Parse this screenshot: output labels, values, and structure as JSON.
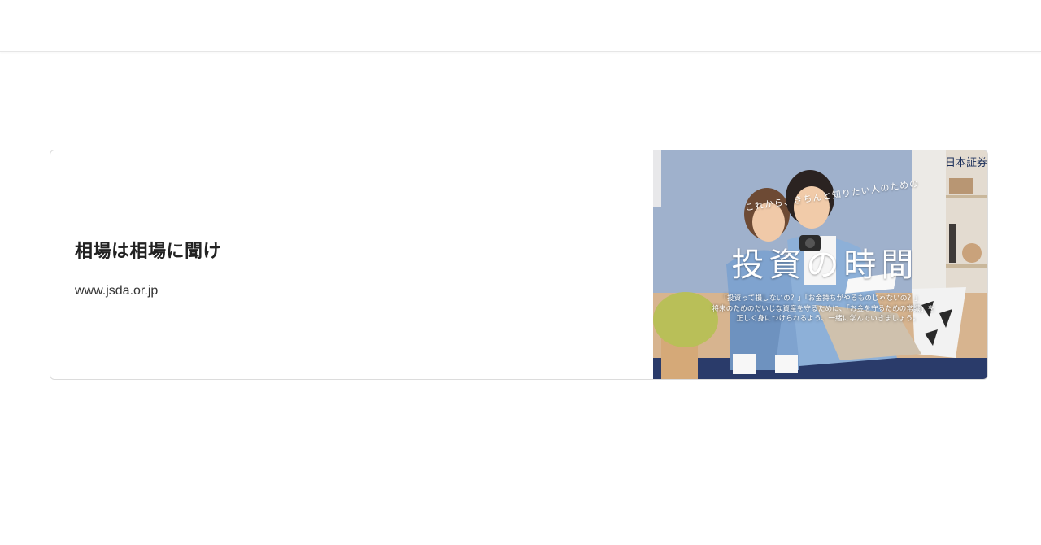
{
  "link_card": {
    "title": "相場は相場に聞け",
    "url": "www.jsda.or.jp",
    "thumbnail": {
      "subtitle": "これから、きちんと知りたい人のための",
      "title": "投資の時間",
      "caption_lines": [
        "「投資って損しないの？」「お金持ちがやるものじゃないの？」",
        "将来のためのだいじな資産を守るために、「お金を守るための常識」を",
        "正しく身につけられるよう、一緒に学んでいきましょう。"
      ],
      "logo_text": "日本証券"
    }
  }
}
